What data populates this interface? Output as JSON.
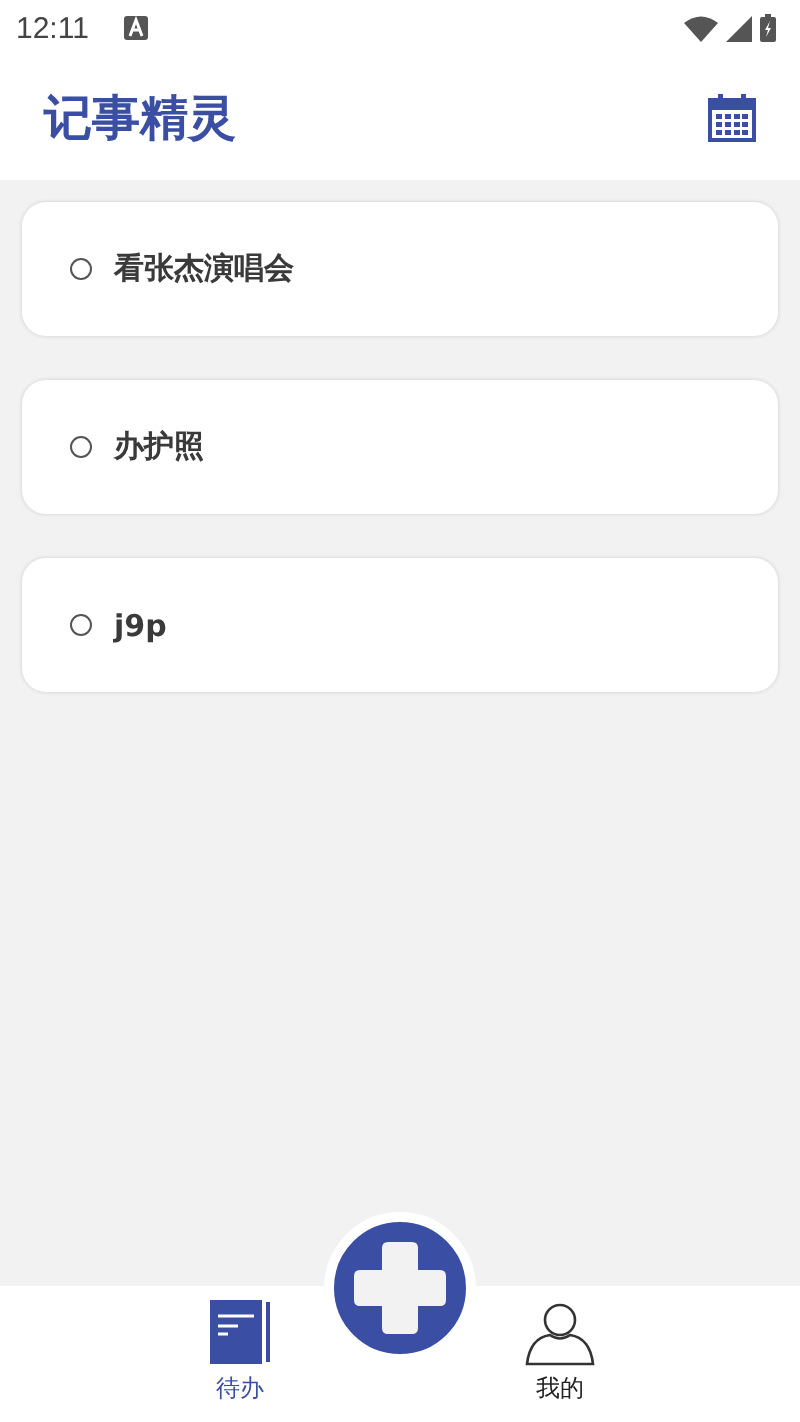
{
  "status_bar": {
    "time": "12:11"
  },
  "header": {
    "title": "记事精灵"
  },
  "todos": [
    {
      "text": "看张杰演唱会",
      "done": false
    },
    {
      "text": "办护照",
      "done": false
    },
    {
      "text": "j9p",
      "done": false
    }
  ],
  "tabs": [
    {
      "label": "待办",
      "kind": "notebook",
      "selected": true
    },
    {
      "label": "我的",
      "kind": "person",
      "selected": false
    }
  ]
}
